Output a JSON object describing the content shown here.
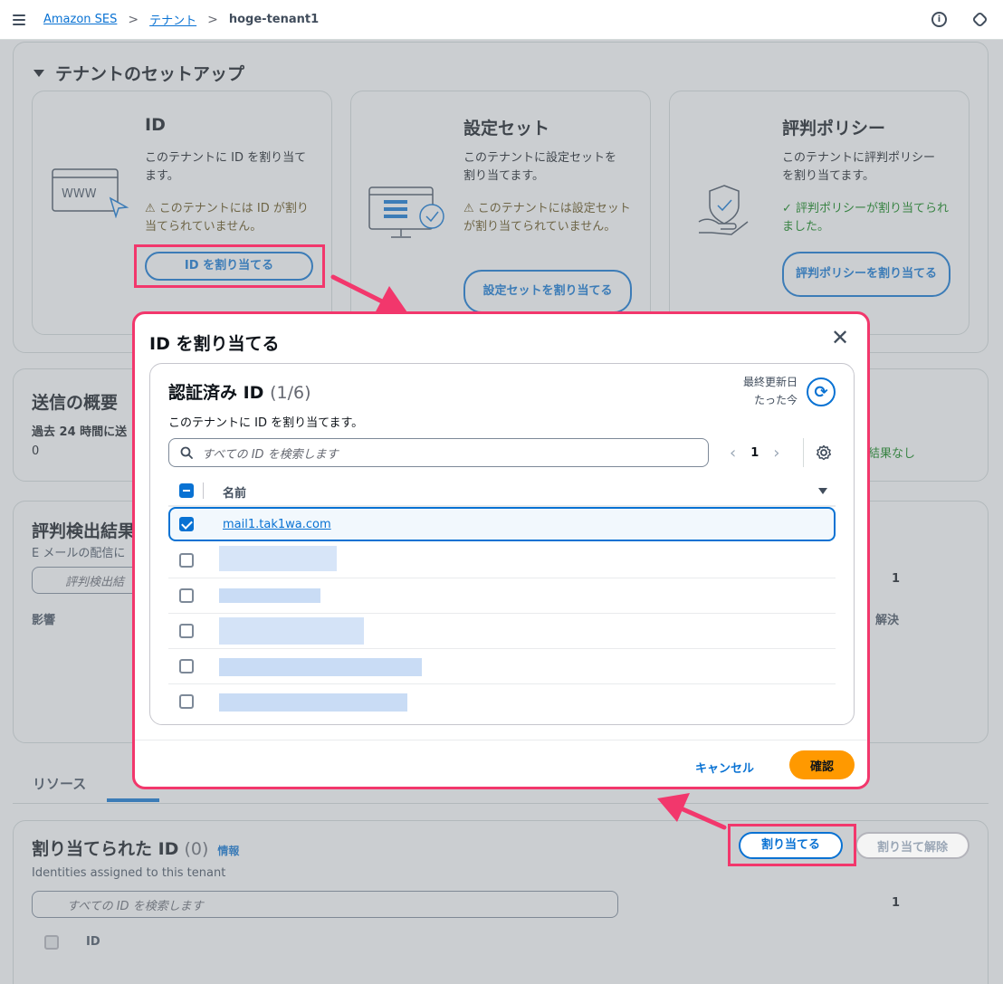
{
  "breadcrumb": {
    "items": [
      "Amazon SES",
      "テナント"
    ],
    "separator": ">",
    "current": "hoge-tenant1"
  },
  "topbar": {
    "info_icon": "info-icon",
    "settings_icon": "settings-icon"
  },
  "setup": {
    "title": "テナントのセットアップ",
    "cards": [
      {
        "title": "ID",
        "desc": "このテナントに ID を割り当てます。",
        "status": "このテナントには ID が割り当てられていません。",
        "status_type": "warning",
        "button": "ID を割り当てる",
        "illustration": "www-browser-illustration"
      },
      {
        "title": "設定セット",
        "desc": "このテナントに設定セットを割り当てます。",
        "status": "このテナントには設定セットが割り当てられていません。",
        "status_type": "warning",
        "button": "設定セットを割り当てる",
        "illustration": "monitor-checklist-illustration"
      },
      {
        "title": "評判ポリシー",
        "desc": "このテナントに評判ポリシーを割り当てます。",
        "status": "評判ポリシーが割り当てられました。",
        "status_type": "success",
        "button": "評判ポリシーを割り当てる",
        "illustration": "shield-hand-illustration"
      }
    ]
  },
  "sending": {
    "title": "送信の概要",
    "label": "過去 24 時間に送",
    "value": "0",
    "right_note": "結果なし"
  },
  "reputation": {
    "title": "評判検出結果",
    "desc": "E メールの配信に",
    "search_placeholder": "評判検出結",
    "page": "1",
    "col_impact": "影響",
    "col_resolve": "解決"
  },
  "tabs": {
    "resources": "リソース"
  },
  "assigned": {
    "title": "割り当てられた ID",
    "count": "(0)",
    "info": "情報",
    "desc": "Identities assigned to this tenant",
    "search_placeholder": "すべての ID を検索します",
    "page": "1",
    "col_id": "ID",
    "assign_button": "割り当てる",
    "unassign_button": "割り当て解除"
  },
  "modal": {
    "title": "ID を割り当てる",
    "close_icon": "close-icon",
    "container_title": "認証済み ID",
    "container_count": "(1/6)",
    "last_updated_label": "最終更新日",
    "last_updated_value": "たった今",
    "refresh_icon": "refresh-icon",
    "desc": "このテナントに ID を割り当てます。",
    "search_placeholder": "すべての ID を検索します",
    "page": "1",
    "column_name": "名前",
    "rows": [
      {
        "name": "mail1.tak1wa.com",
        "checked": true,
        "redacted": false
      },
      {
        "name": "",
        "checked": false,
        "redacted": true
      },
      {
        "name": "",
        "checked": false,
        "redacted": true
      },
      {
        "name": "",
        "checked": false,
        "redacted": true
      },
      {
        "name": "",
        "checked": false,
        "redacted": true
      },
      {
        "name": "",
        "checked": false,
        "redacted": true
      }
    ],
    "cancel": "キャンセル",
    "confirm": "確認"
  },
  "colors": {
    "accent": "#0972d3",
    "primary_button": "#ff9900",
    "annotation": "#f2376c",
    "warning_text": "#5f4a10",
    "success_text": "#037f0c"
  }
}
